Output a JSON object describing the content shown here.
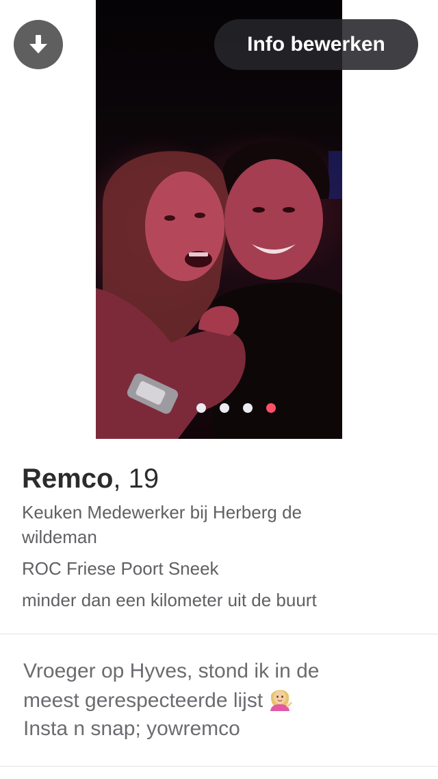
{
  "header": {
    "edit_label": "Info bewerken",
    "collapse_icon": "arrow-down-icon"
  },
  "photos": {
    "count": 4,
    "active_index": 3,
    "active_color": "#fd5068",
    "inactive_color": "#ecebf1"
  },
  "profile": {
    "name": "Remco",
    "age_text": ", 19",
    "job_line_1": "Keuken Medewerker bij Herberg de",
    "job_line_2": "wildeman",
    "school": "ROC Friese Poort Sneek",
    "distance": "minder dan een kilometer uit de buurt"
  },
  "bio": {
    "line_1": "Vroeger op Hyves, stond ik in de",
    "line_2": "meest gerespecteerde lijst",
    "line_2_emoji": "information-desk-person-emoji",
    "line_3": "Insta n snap; yowremco"
  }
}
